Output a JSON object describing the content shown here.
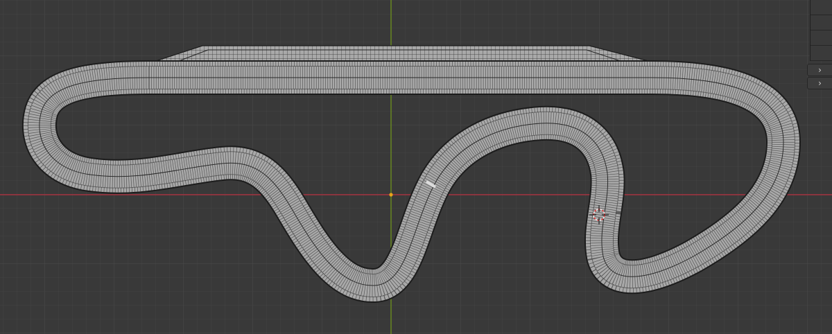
{
  "viewport": {
    "background": "#393939",
    "grid_color": "#454545",
    "x_axis_color": "#a3313e",
    "y_axis_color": "#6a8d1f",
    "origin_color": "#e8a21a",
    "mesh_fill": "#a9a9a9",
    "mesh_wire": "#1c1c1c"
  },
  "panel": {
    "expander_1": "›",
    "expander_2": "›"
  },
  "icons": {
    "cursor": "3d-cursor-icon",
    "origin": "origin-point-icon"
  }
}
